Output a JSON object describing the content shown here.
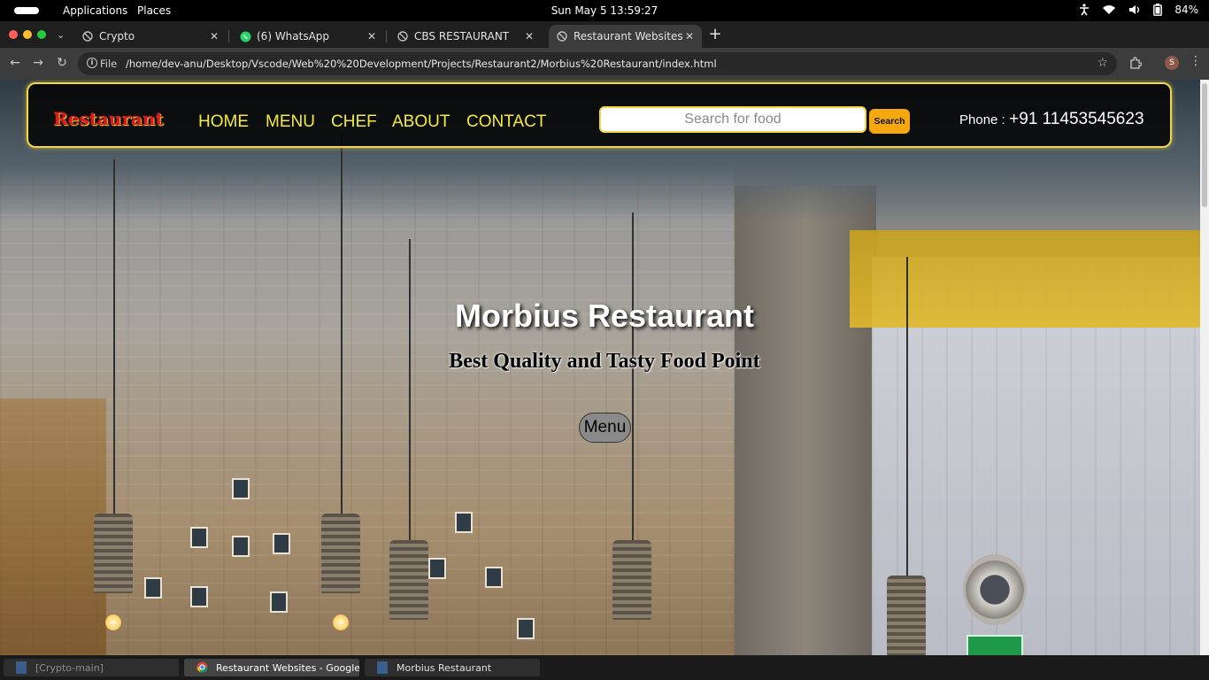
{
  "topbar": {
    "applications": "Applications",
    "places": "Places",
    "clock": "Sun May 5  13:59:27",
    "battery": "84%"
  },
  "browser": {
    "tabs": [
      {
        "title": "Crypto",
        "favicon": "globe-icon"
      },
      {
        "title": "(6) WhatsApp",
        "favicon": "whatsapp-icon"
      },
      {
        "title": "CBS RESTAURANT",
        "favicon": "globe-icon"
      },
      {
        "title": "Restaurant Websites",
        "favicon": "globe-icon",
        "active": true
      }
    ],
    "omnibox": {
      "scheme_label": "File",
      "url": "/home/dev-anu/Desktop/Vscode/Web%20%20Development/Projects/Restaurant2/Morbius%20Restaurant/index.html"
    },
    "profile_initial": "S"
  },
  "site": {
    "logo": "Restaurant",
    "nav": [
      "HOME",
      "MENU",
      "CHEF",
      "ABOUT",
      "CONTACT"
    ],
    "search_placeholder": "Search for food",
    "search_button": "Search",
    "phone_label": "Phone :",
    "phone_number": "+91 11453545623",
    "hero_title": "Morbius Restaurant",
    "hero_subtitle": "Best Quality and Tasty Food Point",
    "hero_button": "Menu"
  },
  "windowlist": [
    {
      "label": "[Crypto-main]",
      "dim": true
    },
    {
      "label": "Restaurant Websites - Google Ch...",
      "active": true
    },
    {
      "label": "Morbius Restaurant"
    }
  ],
  "colors": {
    "nav_border": "#f5d742",
    "nav_link": "#f5ec38",
    "logo": "#e0161a",
    "search_button": "#f5a80d"
  }
}
